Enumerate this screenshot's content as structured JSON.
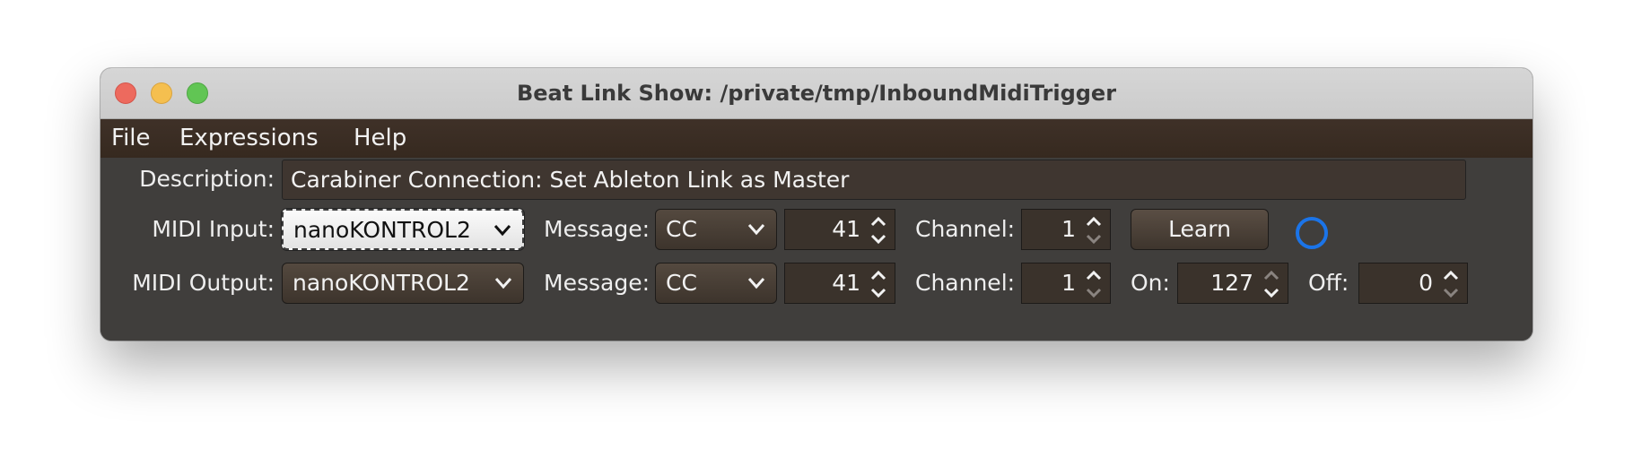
{
  "window": {
    "title": "Beat Link Show: /private/tmp/InboundMidiTrigger"
  },
  "menu": {
    "items": [
      "File",
      "Expressions",
      "Help"
    ]
  },
  "form": {
    "description_label": "Description:",
    "description_value": "Carabiner Connection: Set Ableton Link as Master",
    "input": {
      "label": "MIDI Input:",
      "device": "nanoKONTROL2",
      "message_label": "Message:",
      "message": "CC",
      "number": "41",
      "channel_label": "Channel:",
      "channel": "1",
      "learn_label": "Learn"
    },
    "output": {
      "label": "MIDI Output:",
      "device": "nanoKONTROL2",
      "message_label": "Message:",
      "message": "CC",
      "number": "41",
      "channel_label": "Channel:",
      "channel": "1",
      "on_label": "On:",
      "on_value": "127",
      "off_label": "Off:",
      "off_value": "0"
    }
  },
  "colors": {
    "indicator": "#1b74e8",
    "menubar": "#3a2c22",
    "content_bg": "#403e3c"
  },
  "icons": [
    "close-light",
    "minimize-light",
    "zoom-light",
    "chevron-down-icon",
    "spinner-arrows-icon",
    "status-indicator-icon"
  ]
}
